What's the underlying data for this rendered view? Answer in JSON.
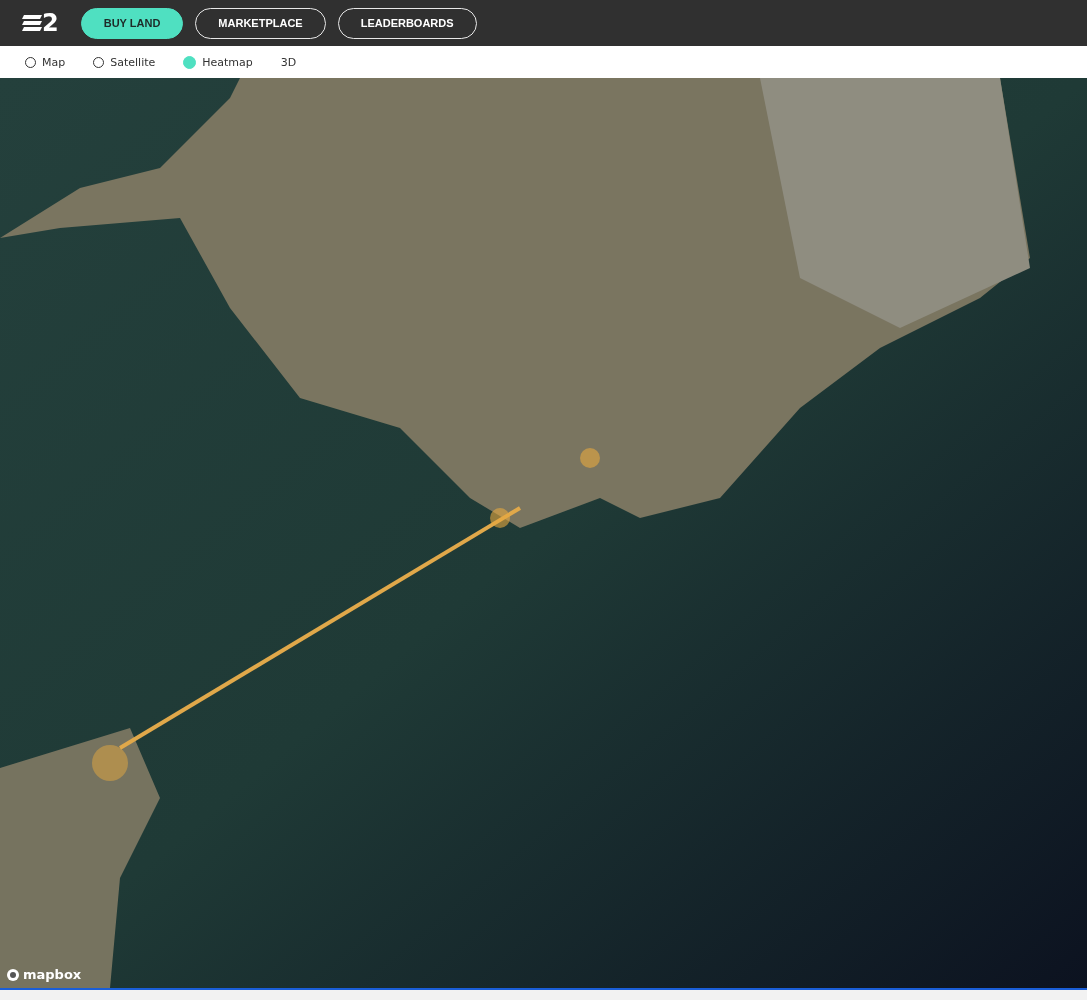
{
  "header": {
    "logo": {
      "text": "2"
    },
    "nav": [
      {
        "label": "BUY LAND",
        "selected": true
      },
      {
        "label": "MARKETPLACE",
        "selected": false
      },
      {
        "label": "LEADERBOARDS",
        "selected": false
      }
    ]
  },
  "map_styles": [
    {
      "kind": "radio",
      "label": "Map",
      "selected": false
    },
    {
      "kind": "radio",
      "label": "Satellite",
      "selected": false
    },
    {
      "kind": "radio",
      "label": "Heatmap",
      "selected": true
    },
    {
      "kind": "toggle",
      "label": "3D",
      "selected": false
    }
  ],
  "map": {
    "attribution": "mapbox"
  }
}
